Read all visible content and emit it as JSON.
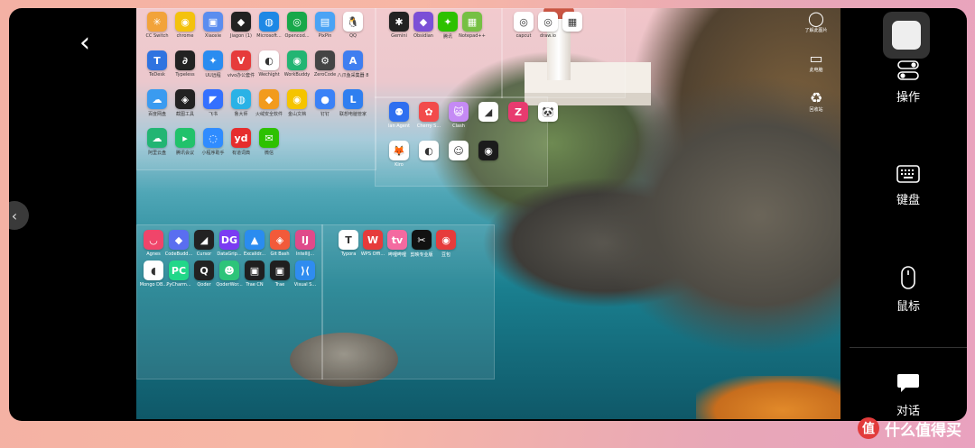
{
  "nav": {
    "back_glyph": "‹",
    "side_glyph": "‹"
  },
  "right_panel": {
    "toggle_icon": "toggle-icon",
    "operate_label": "操作",
    "keyboard_label": "键盘",
    "mouse_label": "鼠标",
    "chat_label": "对话"
  },
  "desktop_icons": {
    "group1": [
      {
        "label": "CC Switch",
        "color": "#f2a33a",
        "glyph": "✳"
      },
      {
        "label": "chrome",
        "color": "#f4c20d",
        "glyph": "◉"
      },
      {
        "label": "Xiaoxie",
        "color": "#5b8def",
        "glyph": "▣"
      },
      {
        "label": "Jiagon (1)",
        "color": "#222222",
        "glyph": "◆"
      },
      {
        "label": "Microsoft...",
        "color": "#1e88e5",
        "glyph": "◍"
      },
      {
        "label": "Opencod...",
        "color": "#18a84a",
        "glyph": "◎"
      },
      {
        "label": "PixPin",
        "color": "#4aa3f5",
        "glyph": "▤"
      },
      {
        "label": "QQ",
        "color": "#ffffff",
        "glyph": "🐧"
      },
      {
        "label": "TeDesk",
        "color": "#2f73e0",
        "glyph": "T"
      },
      {
        "label": "Typeless",
        "color": "#222222",
        "glyph": "∂"
      },
      {
        "label": "UU远程",
        "color": "#2a8cf0",
        "glyph": "✦"
      },
      {
        "label": "vivo办公套件",
        "color": "#e63b3b",
        "glyph": "V"
      },
      {
        "label": "Wechight",
        "color": "#ffffff",
        "glyph": "◐"
      },
      {
        "label": "WorkBuddy",
        "color": "#22b573",
        "glyph": "◉"
      },
      {
        "label": "ZeroCode",
        "color": "#444444",
        "glyph": "⚙"
      },
      {
        "label": "八爪鱼采集器 8",
        "color": "#3f7ef0",
        "glyph": "A"
      },
      {
        "label": "百度网盘",
        "color": "#3a9bf0",
        "glyph": "☁"
      },
      {
        "label": "截图工具",
        "color": "#222222",
        "glyph": "◈"
      },
      {
        "label": "飞书",
        "color": "#3370ff",
        "glyph": "◤"
      },
      {
        "label": "鲁大师",
        "color": "#2ab2e6",
        "glyph": "◍"
      },
      {
        "label": "火绒安全软件",
        "color": "#f29b1d",
        "glyph": "◆"
      },
      {
        "label": "金山文档",
        "color": "#f5c400",
        "glyph": "◉"
      },
      {
        "label": "钉钉",
        "color": "#3a82f7",
        "glyph": "●"
      },
      {
        "label": "联想电脑管家",
        "color": "#2f7ff0",
        "glyph": "L"
      },
      {
        "label": "阿里云盘",
        "color": "#22b573",
        "glyph": "☁"
      },
      {
        "label": "腾讯会议",
        "color": "#21c26b",
        "glyph": "▸"
      },
      {
        "label": "小程序助手",
        "color": "#2f8cff",
        "glyph": "◌"
      },
      {
        "label": "有道词典",
        "color": "#e62d2d",
        "glyph": "yd"
      },
      {
        "label": "微信",
        "color": "#2dc100",
        "glyph": "✉"
      }
    ],
    "group2": [
      {
        "label": "Gemini",
        "color": "#222222",
        "glyph": "✱"
      },
      {
        "label": "Obsidian",
        "color": "#7b4fd6",
        "glyph": "◆"
      },
      {
        "label": "腾讯",
        "color": "#2dc100",
        "glyph": "✦"
      },
      {
        "label": "Notepad++",
        "color": "#76c043",
        "glyph": "▦"
      }
    ],
    "group3": [
      {
        "label": "capcut",
        "color": "#ffffff",
        "glyph": "◎"
      },
      {
        "label": "draw.io",
        "color": "#ffffff",
        "glyph": "◎"
      },
      {
        "label": "",
        "color": "#ffffff",
        "glyph": "▦"
      }
    ],
    "group4": [
      {
        "label": "lan Agent",
        "color": "#2f6ff0",
        "glyph": "⚉"
      },
      {
        "label": "Cherry S...",
        "color": "#f24b4b",
        "glyph": "✿"
      },
      {
        "label": "Clash",
        "color": "#c58af5",
        "glyph": "😺"
      },
      {
        "label": "",
        "color": "#ffffff",
        "glyph": "◢"
      },
      {
        "label": "",
        "color": "#e83b6f",
        "glyph": "Z"
      },
      {
        "label": "",
        "color": "#ffffff",
        "glyph": "🐼"
      },
      {
        "label": "Kiro",
        "color": "#ffffff",
        "glyph": "🦊"
      },
      {
        "label": "",
        "color": "#ffffff",
        "glyph": "◐"
      },
      {
        "label": "",
        "color": "#ffffff",
        "glyph": "☺"
      },
      {
        "label": "",
        "color": "#1b1b1b",
        "glyph": "◉"
      }
    ],
    "group5": [
      {
        "label": "Agnes",
        "color": "#f0456a",
        "glyph": "◡"
      },
      {
        "label": "CodeBudd...",
        "color": "#5a6ef0",
        "glyph": "◆"
      },
      {
        "label": "Cursor",
        "color": "#222222",
        "glyph": "◢"
      },
      {
        "label": "DataGrip...",
        "color": "#7a3cf2",
        "glyph": "DG"
      },
      {
        "label": "Excalidr...",
        "color": "#2a8cf0",
        "glyph": "▲"
      },
      {
        "label": "Git Bash",
        "color": "#f25a3a",
        "glyph": "◈"
      },
      {
        "label": "IntelliJ...",
        "color": "#e04a8a",
        "glyph": "IJ"
      },
      {
        "label": "Mongo DB...",
        "color": "#ffffff",
        "glyph": "◖"
      },
      {
        "label": "PyCharm...",
        "color": "#21d789",
        "glyph": "PC"
      },
      {
        "label": "Qoder",
        "color": "#222222",
        "glyph": "Q"
      },
      {
        "label": "QoderWor...",
        "color": "#2dc47a",
        "glyph": "☻"
      },
      {
        "label": "Trae CN",
        "color": "#1f1f1f",
        "glyph": "▣"
      },
      {
        "label": "Trae",
        "color": "#1f1f1f",
        "glyph": "▣"
      },
      {
        "label": "Visual S...",
        "color": "#2f8cf0",
        "glyph": "⟩⟨"
      }
    ],
    "group6": [
      {
        "label": "Typora",
        "color": "#ffffff",
        "glyph": "T"
      },
      {
        "label": "WPS Offi...",
        "color": "#e63b3b",
        "glyph": "W"
      },
      {
        "label": "哔哩哔哩",
        "color": "#f46aa0",
        "glyph": "tv"
      },
      {
        "label": "剪映专业版",
        "color": "#111111",
        "glyph": "✂"
      },
      {
        "label": "豆包",
        "color": "#e63b3b",
        "glyph": "◉"
      }
    ],
    "right_column": [
      {
        "label": "了解此图片",
        "glyph": "◯"
      },
      {
        "label": "此电脑",
        "glyph": "▭"
      },
      {
        "label": "回收站",
        "glyph": "♻"
      }
    ]
  },
  "watermark": {
    "logo": "值",
    "text": "什么值得买"
  }
}
